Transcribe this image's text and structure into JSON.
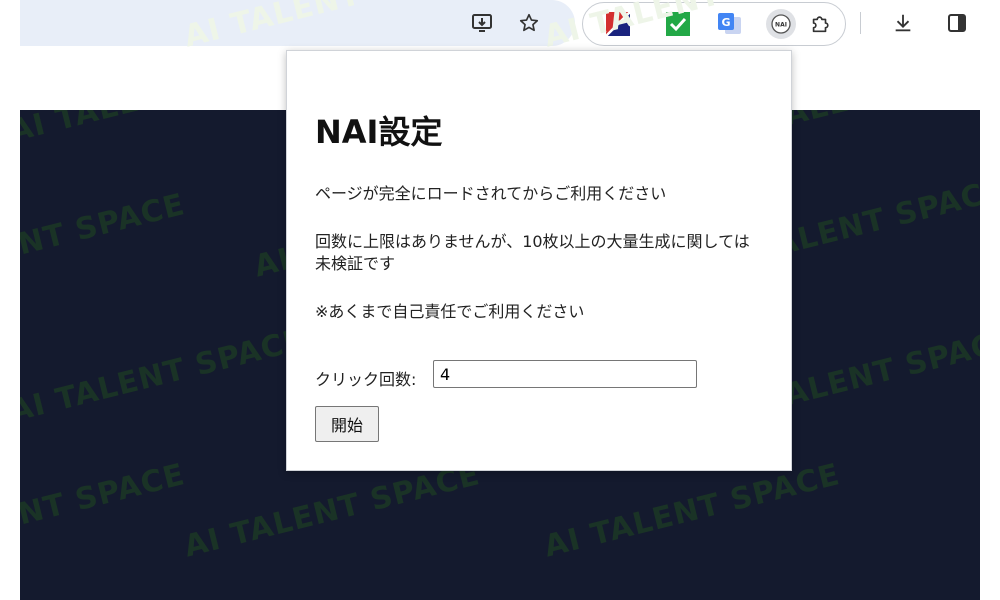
{
  "toolbar": {
    "install_icon": "install-app-icon",
    "bookmark_icon": "star-icon",
    "extensions": [
      {
        "name": "ext-red-blue-icon"
      },
      {
        "name": "ext-green-check-icon"
      },
      {
        "name": "google-translate-icon"
      },
      {
        "name": "nai-extension-icon",
        "label": "NAI"
      }
    ],
    "puzzle_icon": "puzzle-icon",
    "download_icon": "download-icon",
    "side_panel_icon": "side-panel-icon"
  },
  "watermark": {
    "text": "AI TALENT SPACE"
  },
  "popup": {
    "title": "NAI設定",
    "note1": "ページが完全にロードされてからご利用ください",
    "note2": "回数に上限はありませんが、10枚以上の大量生成に関しては未検証です",
    "note3": "※あくまで自己責任でご利用ください",
    "click_count_label": "クリック回数:",
    "click_count_value": "4",
    "start_label": "開始"
  },
  "colors": {
    "page_bg": "#141a2e",
    "watermark": "#1a3326",
    "omnibox": "#e8eef8"
  }
}
